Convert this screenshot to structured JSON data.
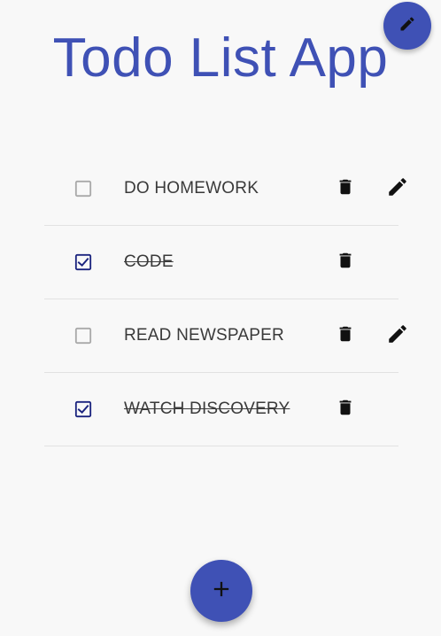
{
  "app": {
    "title": "Todo List App"
  },
  "colors": {
    "primary": "#3f51b5",
    "checked": "#1a237e",
    "background": "#f8f8f8"
  },
  "todos": [
    {
      "text": "DO HOMEWORK",
      "completed": false,
      "editable": true
    },
    {
      "text": "CODE",
      "completed": true,
      "editable": false
    },
    {
      "text": "READ NEWSPAPER",
      "completed": false,
      "editable": true
    },
    {
      "text": "WATCH DISCOVERY",
      "completed": true,
      "editable": false
    }
  ],
  "icons": {
    "top_fab": "pencil-icon",
    "add_fab": "plus-icon",
    "delete": "trash-icon",
    "edit": "pencil-icon"
  }
}
